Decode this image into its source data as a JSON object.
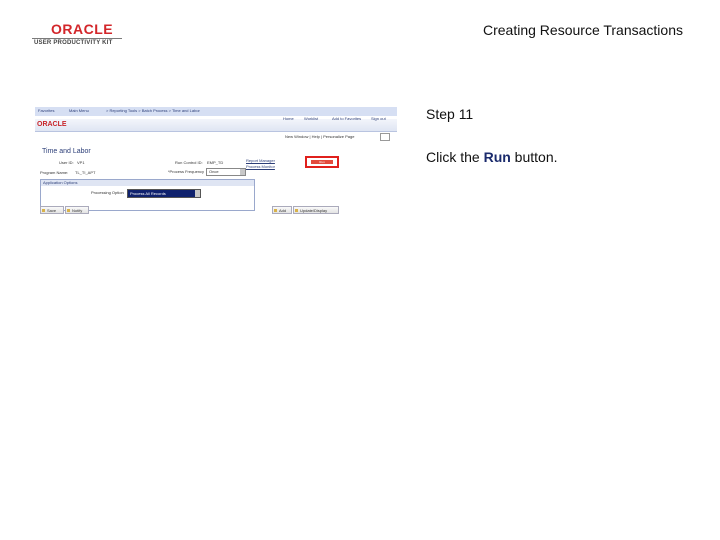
{
  "logo": {
    "word": "ORACLE",
    "sub": "USER PRODUCTIVITY KIT"
  },
  "header": {
    "title": "Creating Resource Transactions"
  },
  "screenshot": {
    "nav": [
      "Favorites",
      "Main Menu",
      "> Reporting Tools > Batch Process > Time and Labor"
    ],
    "logo_text": "ORACLE",
    "top_links": [
      "Home",
      "Worklist",
      "Add to Favorites",
      "Sign out"
    ],
    "new_window": "New Window | Help | Personalize Page",
    "heading": "Time and Labor",
    "user_id_label": "User ID:",
    "user_id_value": "VP1",
    "run_control_label": "Run Control ID:",
    "run_control_value": "EMP_TD",
    "report_manager": "Report Manager",
    "process_monitor": "Process Monitor",
    "run_label": "Run",
    "program_name": "Program Name:",
    "program_value": "TL_TI_APT",
    "process_frequency_label": "*Process Frequency",
    "process_frequency_value": "Once",
    "section_title": "Application Options",
    "processing_option_label": "Processing Option",
    "processing_option_value": "Process All Records",
    "buttons": [
      "Save",
      "Notify",
      "Add",
      "Update/Display"
    ]
  },
  "step": {
    "label": "Step 11"
  },
  "instruction": {
    "prefix": "Click the ",
    "bold": "Run",
    "suffix": " button."
  }
}
